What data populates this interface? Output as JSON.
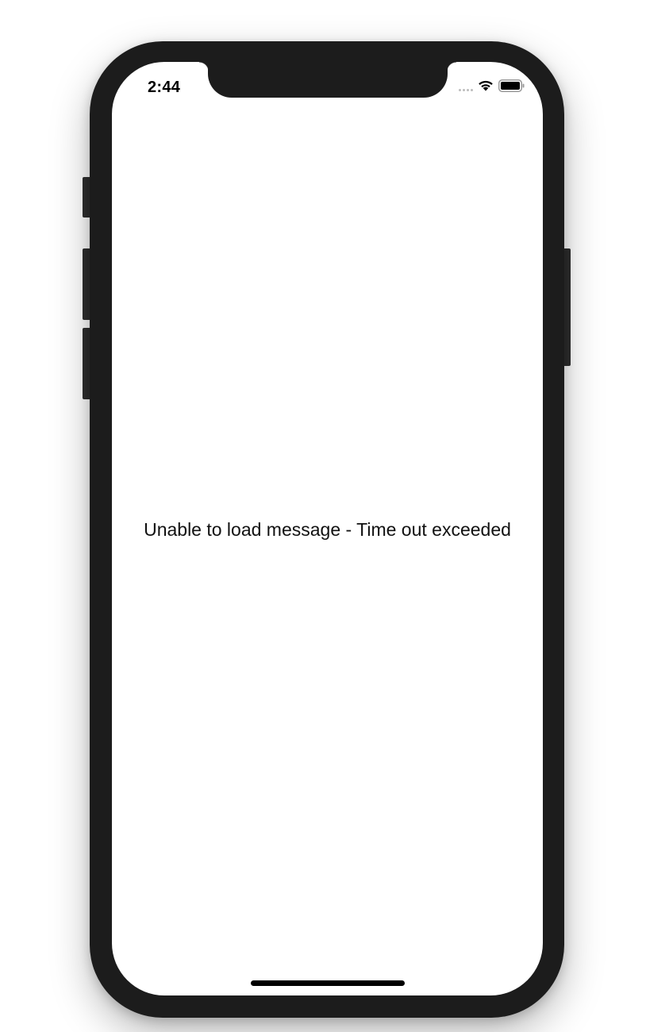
{
  "status_bar": {
    "time": "2:44",
    "signal_icon": "cellular-signal-dots-icon",
    "wifi_icon": "wifi-icon",
    "battery_icon": "battery-icon"
  },
  "content": {
    "message": "Unable to load message - Time out exceeded"
  },
  "colors": {
    "device_frame": "#1c1c1c",
    "screen_background": "#ffffff",
    "text": "#111111"
  }
}
